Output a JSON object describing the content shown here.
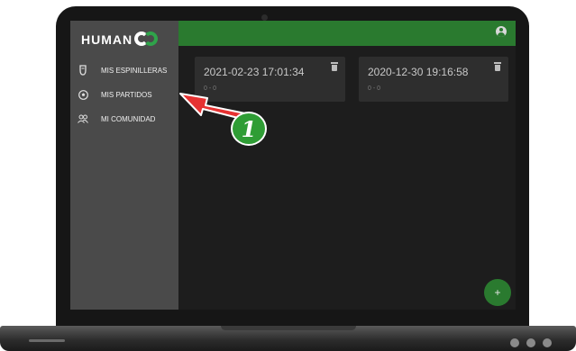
{
  "app": {
    "logo_text": "HUMAN"
  },
  "sidebar": {
    "items": [
      {
        "label": "MIS ESPINILLERAS",
        "icon": "shin-guard-icon"
      },
      {
        "label": "MIS PARTIDOS",
        "icon": "soccer-ball-icon"
      },
      {
        "label": "MI COMUNIDAD",
        "icon": "people-icon"
      }
    ]
  },
  "topbar": {
    "account_icon": "account-circle-icon"
  },
  "matches": [
    {
      "date": "2021-02-23 17:01:34",
      "score": "0 - 0"
    },
    {
      "date": "2020-12-30 19:16:58",
      "score": "0 - 0"
    }
  ],
  "fab": {
    "label": "+"
  },
  "annotation": {
    "step": "1"
  },
  "colors": {
    "accent": "#2a7a2f",
    "arrow": "#e63232",
    "sidebar": "#4a4a4a",
    "content": "#1d1d1d"
  }
}
